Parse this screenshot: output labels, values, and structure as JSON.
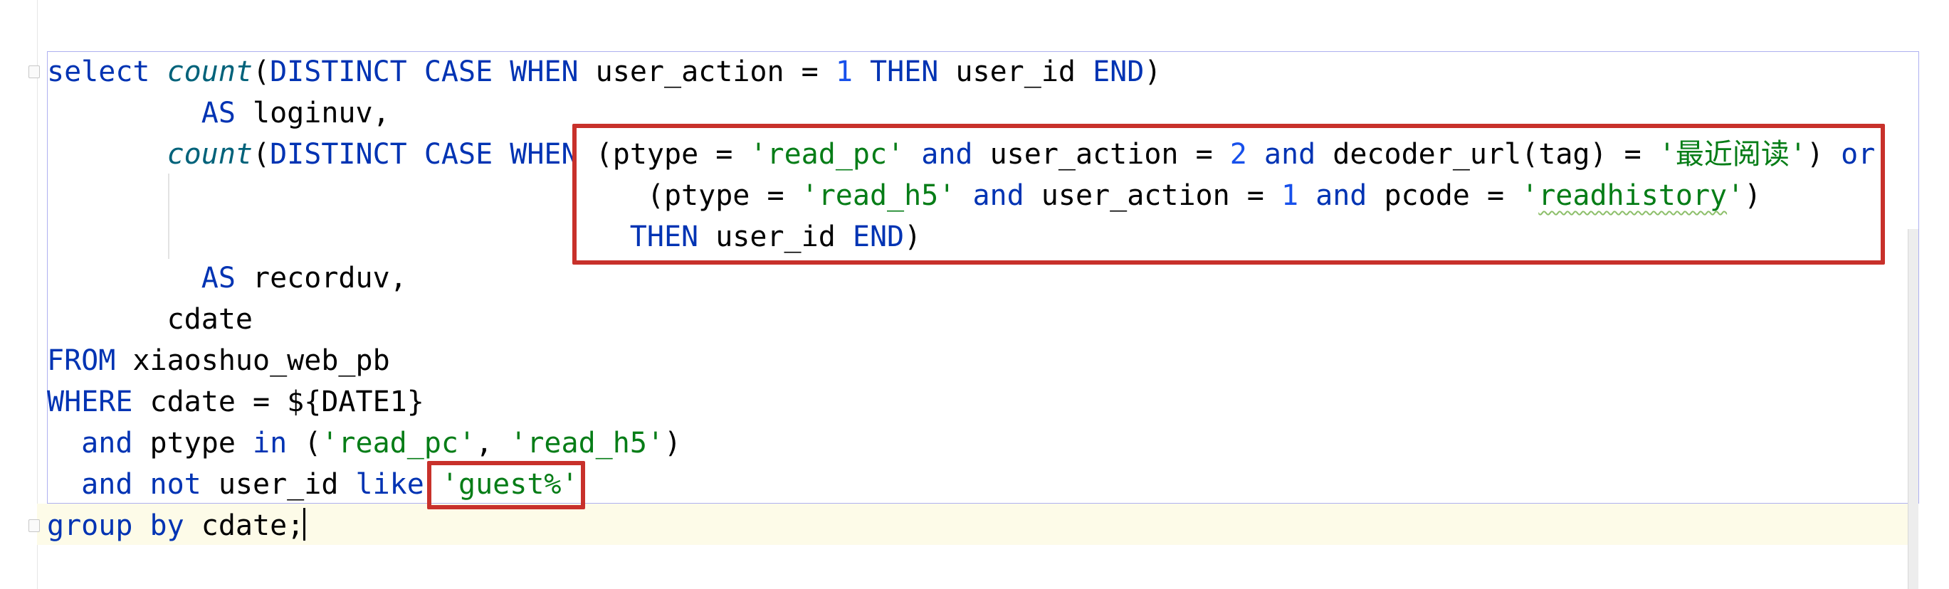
{
  "editor": {
    "language": "SQL",
    "lines": [
      [
        {
          "t": "select ",
          "c": "kw"
        },
        {
          "t": "count",
          "c": "fn"
        },
        {
          "t": "(",
          "c": ""
        },
        {
          "t": "DISTINCT CASE WHEN ",
          "c": "kw"
        },
        {
          "t": "user_action = ",
          "c": ""
        },
        {
          "t": "1",
          "c": "num"
        },
        {
          "t": " ",
          "c": ""
        },
        {
          "t": "THEN ",
          "c": "kw"
        },
        {
          "t": "user_id ",
          "c": ""
        },
        {
          "t": "END",
          "c": "kw"
        },
        {
          "t": ")",
          "c": ""
        }
      ],
      [
        {
          "t": "         ",
          "c": ""
        },
        {
          "t": "AS ",
          "c": "kw"
        },
        {
          "t": "loginuv,",
          "c": ""
        }
      ],
      [
        {
          "t": "       ",
          "c": ""
        },
        {
          "t": "count",
          "c": "fn"
        },
        {
          "t": "(",
          "c": ""
        },
        {
          "t": "DISTINCT CASE WHEN ",
          "c": "kw"
        },
        {
          "t": "(ptype = ",
          "c": ""
        },
        {
          "t": "'read_pc'",
          "c": "str"
        },
        {
          "t": " ",
          "c": ""
        },
        {
          "t": "and ",
          "c": "kw"
        },
        {
          "t": "user_action = ",
          "c": ""
        },
        {
          "t": "2",
          "c": "num"
        },
        {
          "t": " ",
          "c": ""
        },
        {
          "t": "and ",
          "c": "kw"
        },
        {
          "t": "decoder_url(tag) = ",
          "c": ""
        },
        {
          "t": "'最近阅读'",
          "c": "str"
        },
        {
          "t": ") ",
          "c": ""
        },
        {
          "t": "or",
          "c": "kw"
        }
      ],
      [
        {
          "t": "                                   (ptype = ",
          "c": ""
        },
        {
          "t": "'read_h5'",
          "c": "str"
        },
        {
          "t": " ",
          "c": ""
        },
        {
          "t": "and ",
          "c": "kw"
        },
        {
          "t": "user_action = ",
          "c": ""
        },
        {
          "t": "1",
          "c": "num"
        },
        {
          "t": " ",
          "c": ""
        },
        {
          "t": "and ",
          "c": "kw"
        },
        {
          "t": "pcode = ",
          "c": ""
        },
        {
          "t": "'",
          "c": "str"
        },
        {
          "t": "readhistory",
          "c": "str squiggle"
        },
        {
          "t": "'",
          "c": "str"
        },
        {
          "t": ")",
          "c": ""
        }
      ],
      [
        {
          "t": "                                  ",
          "c": ""
        },
        {
          "t": "THEN ",
          "c": "kw"
        },
        {
          "t": "user_id ",
          "c": ""
        },
        {
          "t": "END",
          "c": "kw"
        },
        {
          "t": ")",
          "c": ""
        }
      ],
      [
        {
          "t": "         ",
          "c": ""
        },
        {
          "t": "AS ",
          "c": "kw"
        },
        {
          "t": "recorduv,",
          "c": ""
        }
      ],
      [
        {
          "t": "       cdate",
          "c": ""
        }
      ],
      [
        {
          "t": "FROM ",
          "c": "kw"
        },
        {
          "t": "xiaoshuo_web_pb",
          "c": ""
        }
      ],
      [
        {
          "t": "WHERE ",
          "c": "kw"
        },
        {
          "t": "cdate = ${DATE1}",
          "c": ""
        }
      ],
      [
        {
          "t": "  ",
          "c": ""
        },
        {
          "t": "and ",
          "c": "kw"
        },
        {
          "t": "ptype ",
          "c": ""
        },
        {
          "t": "in ",
          "c": "kw"
        },
        {
          "t": "(",
          "c": ""
        },
        {
          "t": "'read_pc'",
          "c": "str"
        },
        {
          "t": ", ",
          "c": ""
        },
        {
          "t": "'read_h5'",
          "c": "str"
        },
        {
          "t": ")",
          "c": ""
        }
      ],
      [
        {
          "t": "  ",
          "c": ""
        },
        {
          "t": "and not ",
          "c": "kw"
        },
        {
          "t": "user_id ",
          "c": ""
        },
        {
          "t": "like ",
          "c": "kw"
        },
        {
          "t": "'guest%'",
          "c": "str"
        }
      ],
      [
        {
          "t": "group by ",
          "c": "kw"
        },
        {
          "t": "cdate;",
          "c": ""
        }
      ]
    ]
  },
  "colors": {
    "keyword": "#0033b3",
    "function": "#00627a",
    "string": "#067d17",
    "number": "#1750eb",
    "highlight_border": "#c8312b",
    "statement_border": "#aeb0f0",
    "caret_line": "#fdfbe8"
  },
  "icons": {
    "fold_start": "fold-marker-icon",
    "fold_end": "fold-end-icon"
  }
}
